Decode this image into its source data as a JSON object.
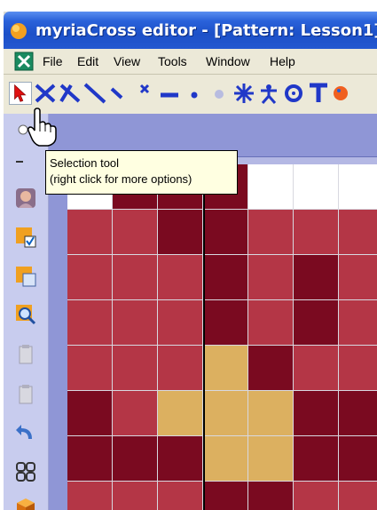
{
  "window": {
    "title": "myriaCross editor - [Pattern: Lesson1]",
    "icon": "app-logo-icon"
  },
  "menu": {
    "items": [
      "File",
      "Edit",
      "View",
      "Tools",
      "Window",
      "Help"
    ]
  },
  "toolbar": {
    "tools": [
      {
        "icon": "selection-tool-icon",
        "active": true
      },
      {
        "icon": "full-cross-icon"
      },
      {
        "icon": "half-cross-icon"
      },
      {
        "icon": "backstitch-icon"
      },
      {
        "icon": "quarter-stitch-icon"
      },
      {
        "icon": "small-cross-icon"
      },
      {
        "icon": "straight-stitch-icon"
      },
      {
        "icon": "bead-icon"
      },
      {
        "icon": "french-knot-icon"
      },
      {
        "icon": "star-stitch-icon"
      },
      {
        "icon": "figure-stitch-icon"
      },
      {
        "icon": "eyelet-icon"
      },
      {
        "icon": "text-tool-icon"
      }
    ]
  },
  "tooltip": {
    "line1": "Selection tool",
    "line2": "(right click for more options)"
  },
  "sidebar": {
    "items": [
      "person-photo-icon",
      "palette-check-icon",
      "copy-pattern-icon",
      "zoom-icon",
      "paste-icon",
      "paste-special-icon",
      "undo-arrow-icon",
      "symbols-grid-icon",
      "3d-box-icon"
    ]
  },
  "colors": {
    "dark_red": "#7a0a20",
    "rose": "#b43646",
    "gold": "#dcb060",
    "background": "#ffffff"
  },
  "pattern": {
    "legend": {
      "W": "background",
      "D": "dark_red",
      "R": "rose",
      "G": "gold"
    },
    "rows": [
      "WDDDWWW",
      "RRDDRRR",
      "RRRDRDR",
      "RRRDRDR",
      "RRRGDRR",
      "DRGGGDD",
      "DDDGGDD",
      "RRRDDRR"
    ]
  }
}
